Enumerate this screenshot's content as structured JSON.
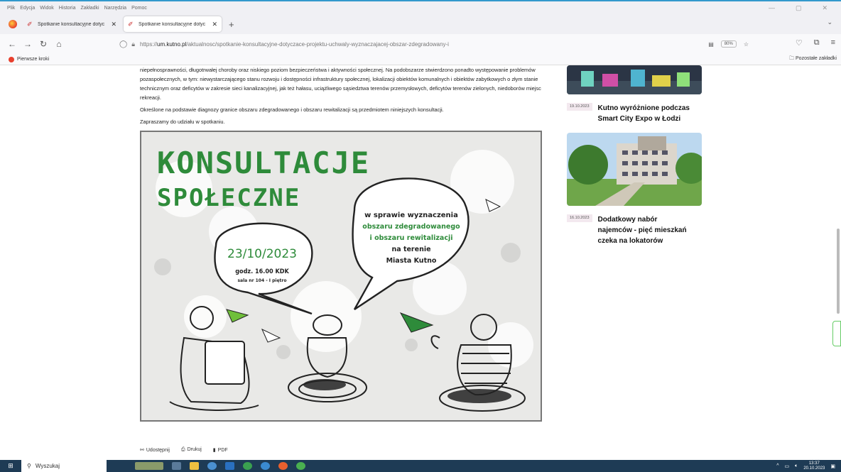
{
  "menubar": {
    "items": [
      "Plik",
      "Edycja",
      "Widok",
      "Historia",
      "Zakładki",
      "Narzędzia",
      "Pomoc"
    ]
  },
  "tabs": [
    {
      "title": "Spotkanie konsultacyjne dotyc"
    },
    {
      "title": "Spotkanie konsultacyjne dotyc"
    }
  ],
  "address": {
    "prefix": "https://",
    "domain": "um.kutno.pl",
    "path": "/aktualnosc/spotkanie-konsultacyjne-dotyczace-projektu-uchwaly-wyznaczajacej-obszar-zdegradowany-i",
    "zoom": "80%"
  },
  "bookmarks": {
    "first": "Pierwsze kroki",
    "other": "Pozostałe zakładki"
  },
  "article": {
    "paragraph1": "niepełnosprawności, długotrwałej choroby oraz niskiego poziom bezpieczeństwa i aktywności społecznej. Na podobszarze stwierdzono ponadto występowanie problemów pozaspołecznych, w tym: niewystarczającego stanu rozwoju i dostępności infrastruktury społecznej, lokalizacji obiektów komunalnych i obiektów zabytkowych o złym stanie technicznym oraz deficytów w zakresie sieci kanalizacyjnej, jak też hałasu, uciążliwego sąsiedztwa terenów przemysłowych, deficytów terenów zielonych, niedoborów miejsc rekreacji.",
    "paragraph2": "Określone na podstawie diagnozy granice obszaru zdegradowanego i obszaru rewitalizacji są przedmiotem niniejszych konsultacji.",
    "paragraph3": "Zapraszamy do udziału w spotkaniu."
  },
  "poster": {
    "title1": "KONSULTACJE",
    "title2": "SPOŁECZNE",
    "date": "23/10/2023",
    "time": "godz. 16.00 KDK",
    "room": "sala nr 104 - I piętro",
    "bubble_line1": "w sprawie wyznaczenia",
    "bubble_line2": "obszaru zdegradowanego",
    "bubble_line3": "i obszaru rewitalizacji",
    "bubble_line4": "na terenie",
    "bubble_line5": "Miasta Kutno",
    "accent": "#2e8b3a"
  },
  "share": {
    "share": "Udostępnij",
    "print": "Drukuj",
    "pdf": "PDF"
  },
  "sidebar": {
    "news": [
      {
        "date": "19.10.2023",
        "title": "Kutno wyróżnione podczas Smart City Expo w Łodzi"
      },
      {
        "date": "16.10.2023",
        "title": "Dodatkowy nabór najemców - pięć mieszkań czeka na lokatorów"
      }
    ]
  },
  "taskbar": {
    "search_placeholder": "Wyszukaj",
    "time": "13:37",
    "date": "20.10.2023"
  }
}
